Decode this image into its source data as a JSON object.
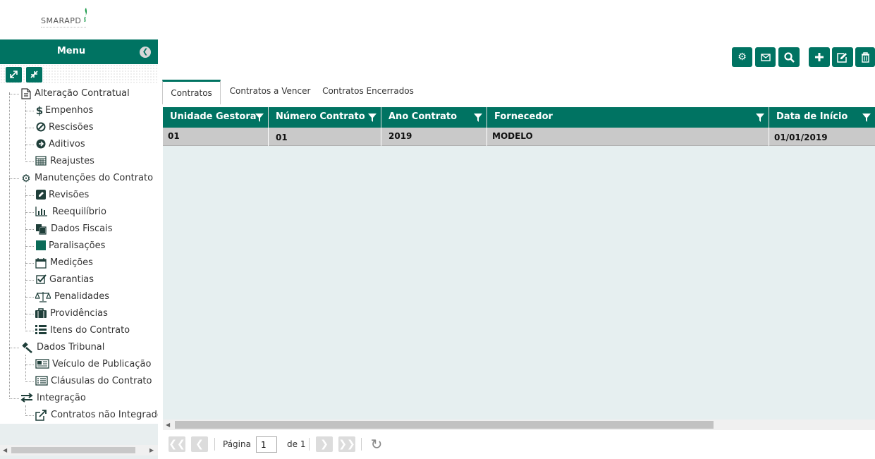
{
  "logo": {
    "text": "SMARAPD"
  },
  "sidebar": {
    "title": "Menu",
    "collapse_icon": "chevron-left-circle-icon",
    "expand_all_icon": "expand-icon",
    "collapse_all_icon": "compress-icon",
    "tree": [
      {
        "label": "Alteração Contratual",
        "icon": "document-icon",
        "level": 0
      },
      {
        "label": "Empenhos",
        "icon": "dollar-icon",
        "level": 1
      },
      {
        "label": "Rescisões",
        "icon": "ban-icon",
        "level": 1
      },
      {
        "label": "Aditivos",
        "icon": "arrow-right-circle-icon",
        "level": 1
      },
      {
        "label": "Reajustes",
        "icon": "calculator-icon",
        "level": 1
      },
      {
        "label": "Manutenções do Contrato",
        "icon": "gear-icon",
        "level": 0
      },
      {
        "label": "Revisões",
        "icon": "edit-icon",
        "level": 1
      },
      {
        "label": "Reequilíbrio",
        "icon": "bar-chart-icon",
        "level": 1
      },
      {
        "label": "Dados Fiscais",
        "icon": "copy-icon",
        "level": 1
      },
      {
        "label": "Paralisações",
        "icon": "stop-icon",
        "level": 1
      },
      {
        "label": "Medições",
        "icon": "calendar-icon",
        "level": 1
      },
      {
        "label": "Garantias",
        "icon": "check-square-icon",
        "level": 1
      },
      {
        "label": "Penalidades",
        "icon": "balance-scale-icon",
        "level": 1
      },
      {
        "label": "Providências",
        "icon": "briefcase-icon",
        "level": 1
      },
      {
        "label": "Itens do Contrato",
        "icon": "list-icon",
        "level": 1
      },
      {
        "label": "Dados Tribunal",
        "icon": "gavel-icon",
        "level": 0
      },
      {
        "label": "Veículo de Publicação",
        "icon": "newspaper-icon",
        "level": 1
      },
      {
        "label": "Cláusulas do Contrato",
        "icon": "list-alt-icon",
        "level": 1
      },
      {
        "label": "Integração",
        "icon": "exchange-icon",
        "level": 0
      },
      {
        "label": "Contratos não Integrados",
        "icon": "external-link-icon",
        "level": 1
      }
    ]
  },
  "toolbar": {
    "settings_icon": "gear-icon",
    "email_icon": "envelope-icon",
    "search_icon": "search-icon",
    "add_icon": "plus-icon",
    "edit_icon": "edit-icon",
    "delete_icon": "trash-icon"
  },
  "tabs": [
    {
      "label": "Contratos",
      "active": true
    },
    {
      "label": "Contratos a Vencer",
      "active": false
    },
    {
      "label": "Contratos Encerrados",
      "active": false
    }
  ],
  "grid": {
    "columns": [
      "Unidade Gestora",
      "Número Contrato",
      "Ano Contrato",
      "Fornecedor",
      "Data de Início"
    ],
    "rows": [
      [
        "01",
        "01",
        "2019",
        "MODELO",
        "01/01/2019"
      ]
    ]
  },
  "pager": {
    "page_label": "Página",
    "page_value": "1",
    "of_label": "de 1"
  },
  "colors": {
    "primary": "#007362",
    "grid_bg": "#e6eff0",
    "row_bg": "#c9c9c9"
  }
}
